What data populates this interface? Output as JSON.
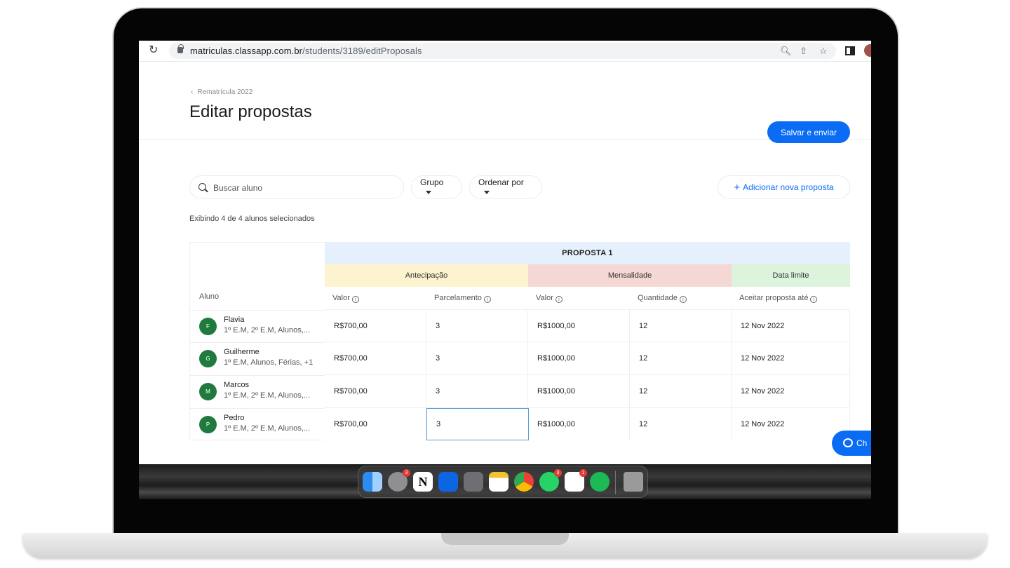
{
  "browser": {
    "url_host": "matriculas.classapp.com.br",
    "url_path": "/students/3189/editProposals"
  },
  "header": {
    "breadcrumb": "Rematrícula 2022",
    "title": "Editar propostas",
    "save_label": "Salvar e enviar"
  },
  "toolbar": {
    "search_placeholder": "Buscar aluno",
    "group_label": "Grupo",
    "order_label": "Ordenar por",
    "add_label": "Adicionar nova proposta",
    "count_text": "Exibindo 4 de 4 alunos selecionados"
  },
  "table": {
    "student_header": "Aluno",
    "proposal_title": "PROPOSTA 1",
    "groups": [
      "Antecipação",
      "Mensalidade",
      "Data limite"
    ],
    "columns": [
      "Valor",
      "Parcelamento",
      "Valor",
      "Quantidade",
      "Aceitar proposta até"
    ],
    "rows": [
      {
        "initial": "F",
        "name": "Flavia",
        "groups": "1º E.M, 2º E.M, Alunos,...",
        "cells": [
          "R$700,00",
          "3",
          "R$1000,00",
          "12",
          "12 Nov 2022"
        ]
      },
      {
        "initial": "G",
        "name": "Guilherme",
        "groups": "1º E.M, Alunos, Férias, +1",
        "cells": [
          "R$700,00",
          "3",
          "R$1000,00",
          "12",
          "12 Nov 2022"
        ]
      },
      {
        "initial": "M",
        "name": "Marcos",
        "groups": "1º E.M, 2º E.M, Alunos,...",
        "cells": [
          "R$700,00",
          "3",
          "R$1000,00",
          "12",
          "12 Nov 2022"
        ]
      },
      {
        "initial": "P",
        "name": "Pedro",
        "groups": "1º E.M, 2º E.M, Alunos,...",
        "cells": [
          "R$700,00",
          "3",
          "R$1000,00",
          "12",
          "12 Nov 2022"
        ]
      }
    ]
  },
  "chat": {
    "label": "Ch"
  },
  "dock": {
    "badges": {
      "settings": "3",
      "whatsapp": "3",
      "slack": "1"
    },
    "items": [
      "finder-icon",
      "system-settings-icon",
      "notion-icon",
      "trello-icon",
      "launchpad-icon",
      "notes-icon",
      "chrome-icon",
      "whatsapp-icon",
      "slack-icon",
      "spotify-icon",
      "trash-icon"
    ]
  },
  "colors": {
    "accent": "#0a6cf5",
    "avatar": "#1e7a3d",
    "proposta_bg": "#e6f0fc",
    "antecipacao_bg": "#fdf3cf",
    "mensalidade_bg": "#f5d8d4",
    "data_limite_bg": "#dcf3dc"
  }
}
